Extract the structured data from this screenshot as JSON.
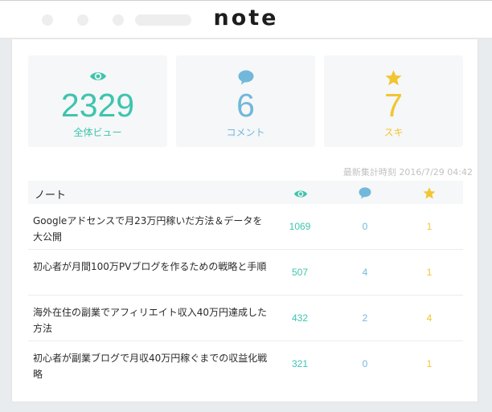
{
  "header": {
    "logo": "note"
  },
  "stats": [
    {
      "icon": "eye-icon",
      "value": "2329",
      "label": "全体ビュー"
    },
    {
      "icon": "comment-icon",
      "value": "6",
      "label": "コメント"
    },
    {
      "icon": "star-icon",
      "value": "7",
      "label": "スキ"
    }
  ],
  "timestamp": "最新集計時刻 2016/7/29 04:42",
  "table": {
    "header_title": "ノート",
    "columns": [
      "eye-icon",
      "comment-icon",
      "star-icon"
    ],
    "rows": [
      {
        "title": "Googleアドセンスで月23万円稼いだ方法＆データを大公開",
        "views": "1069",
        "comments": "0",
        "likes": "1"
      },
      {
        "title": "初心者が月間100万PVブログを作るための戦略と手順",
        "views": "507",
        "comments": "4",
        "likes": "1"
      },
      {
        "title": "海外在住の副業でアフィリエイト収入40万円達成した方法",
        "views": "432",
        "comments": "2",
        "likes": "4"
      },
      {
        "title": "初心者が副業ブログで月収40万円稼ぐまでの収益化戦略",
        "views": "321",
        "comments": "0",
        "likes": "1"
      }
    ]
  },
  "colors": {
    "views": "#3fc4ad",
    "comments": "#72b8db",
    "likes": "#f2c531"
  }
}
